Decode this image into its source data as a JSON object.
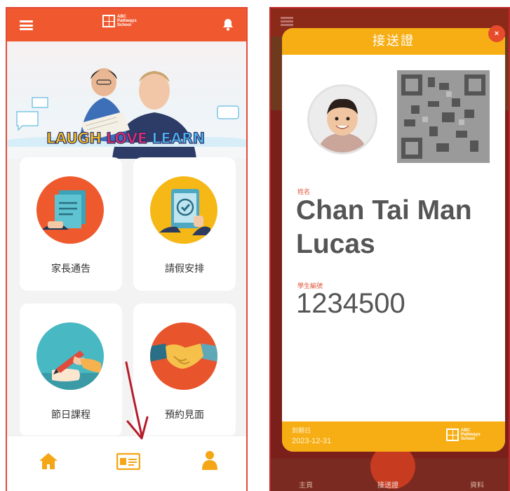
{
  "brand": {
    "logo_text": [
      "ABC",
      "Pathways",
      "School"
    ],
    "accent": "#f0592f",
    "card_accent": "#f6ae14"
  },
  "left_app": {
    "banner_words": [
      "LAUGH",
      "LOVE",
      "LEARN"
    ],
    "tiles": [
      {
        "label": "家長通告",
        "icon": "notice-document-icon"
      },
      {
        "label": "請假安排",
        "icon": "tablet-check-icon"
      },
      {
        "label": "節日課程",
        "icon": "pen-writing-icon"
      },
      {
        "label": "預約見面",
        "icon": "handshake-icon"
      }
    ],
    "nav": [
      {
        "icon": "home-icon"
      },
      {
        "icon": "id-card-icon"
      },
      {
        "icon": "user-icon"
      }
    ]
  },
  "right_app": {
    "card_title": "接送證",
    "close_glyph": "×",
    "name_label": "姓名",
    "name": "Chan Tai Man Lucas",
    "id_label": "學生編號",
    "student_id": "1234500",
    "expiry_label": "到期日",
    "expiry_date": "2023-12-31",
    "nav_labels": [
      "主頁",
      "接送證",
      "資料"
    ]
  }
}
